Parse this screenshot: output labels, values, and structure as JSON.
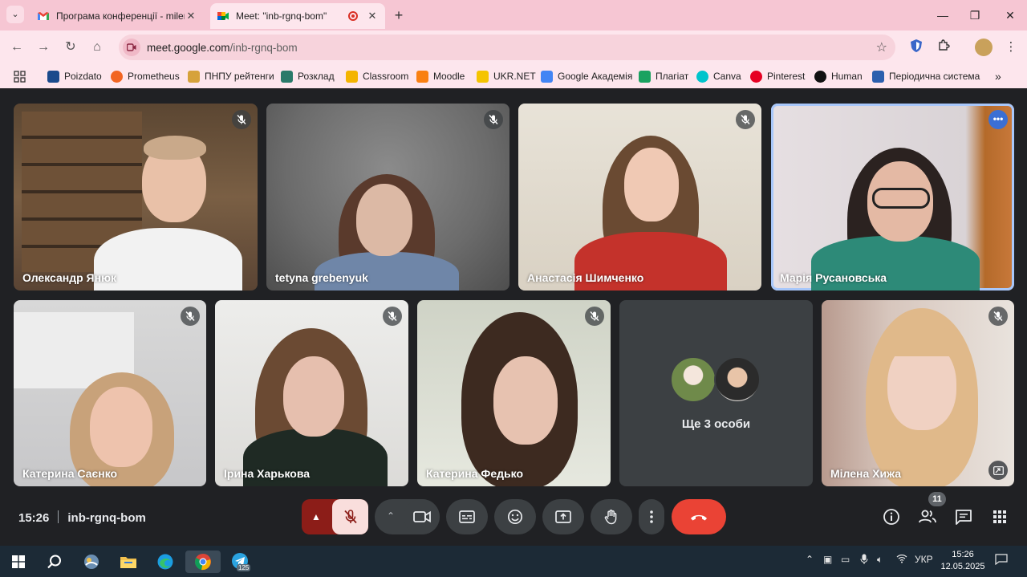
{
  "browser": {
    "tabs": [
      {
        "title": "Програма конференції - milen",
        "active": false
      },
      {
        "title": "Meet: \"inb-rgnq-bom\"",
        "active": true
      }
    ],
    "url_host": "meet.google.com",
    "url_path": "/inb-rgnq-bom"
  },
  "bookmarks": [
    {
      "label": "Poizdato",
      "color": "#1a4a8c"
    },
    {
      "label": "Prometheus",
      "color": "#f26522"
    },
    {
      "label": "ПНПУ рейтенги",
      "color": "#d6a23b"
    },
    {
      "label": "Розклад",
      "color": "#2a7a6a"
    },
    {
      "label": "Classroom",
      "color": "#f4b400"
    },
    {
      "label": "Moodle",
      "color": "#f98012"
    },
    {
      "label": "UKR.NET",
      "color": "#f5c400"
    },
    {
      "label": "Google Академія",
      "color": "#4285f4"
    },
    {
      "label": "Плагіат",
      "color": "#1aa260"
    },
    {
      "label": "Canva",
      "color": "#00c4cc"
    },
    {
      "label": "Pinterest",
      "color": "#e60023"
    },
    {
      "label": "Human",
      "color": "#111111"
    },
    {
      "label": "Періодична система",
      "color": "#2b5fae"
    }
  ],
  "participants": [
    {
      "name": "Олександр Янюк",
      "muted": true
    },
    {
      "name": "tetyna grebenyuk",
      "muted": true
    },
    {
      "name": "Анастасія Шимченко",
      "muted": true
    },
    {
      "name": "Марія Русановська",
      "muted": false,
      "speaking": true
    },
    {
      "name": "Катерина Саєнко",
      "muted": true
    },
    {
      "name": "Ірина Харькова",
      "muted": true
    },
    {
      "name": "Катерина Федько",
      "muted": true
    },
    {
      "name": "Мілена Хижа",
      "muted": true
    }
  ],
  "others": {
    "label": "Ще 3 особи"
  },
  "meeting": {
    "time": "15:26",
    "code": "inb-rgnq-bom",
    "participant_count": "11"
  },
  "taskbar": {
    "language": "УКР",
    "clock_time": "15:26",
    "clock_date": "12.05.2025",
    "telegram_badge": "125"
  },
  "colors": {
    "meet_bg": "#202124",
    "hangup": "#ea4335",
    "mic_off_bg": "#8c1d18",
    "speaker_outline": "#a8c7fa",
    "chrome_tabstrip": "#f6c6d3"
  }
}
